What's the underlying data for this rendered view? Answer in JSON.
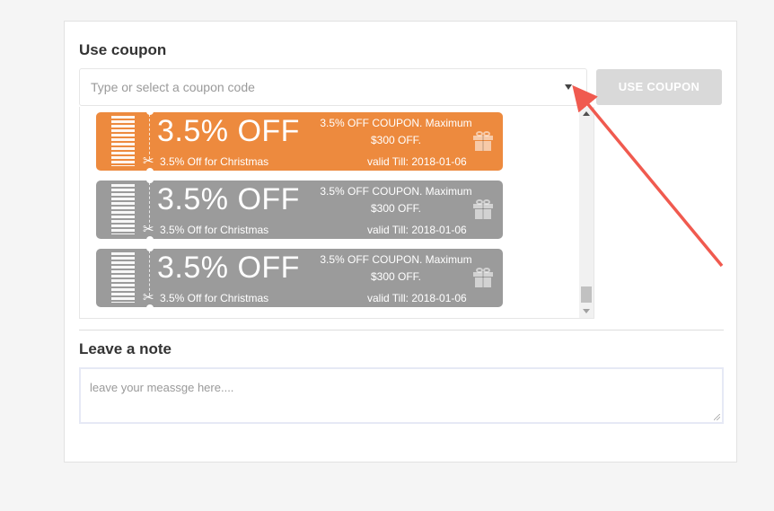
{
  "coupon_section": {
    "title": "Use coupon",
    "input_placeholder": "Type or select a coupon code",
    "use_button_label": "USE COUPON"
  },
  "coupons": [
    {
      "amount": "3.5% OFF",
      "desc_line1": "3.5% OFF COUPON. Maximum",
      "desc_line2": "$300 OFF.",
      "event": "3.5% Off for Christmas",
      "valid": "valid Till: 2018-01-06",
      "color": "#ed8a3e",
      "state": "selected"
    },
    {
      "amount": "3.5% OFF",
      "desc_line1": "3.5% OFF COUPON. Maximum",
      "desc_line2": "$300 OFF.",
      "event": "3.5% Off for Christmas",
      "valid": "valid Till: 2018-01-06",
      "color": "#9b9b9b",
      "state": "normal"
    },
    {
      "amount": "3.5% OFF",
      "desc_line1": "3.5% OFF COUPON. Maximum",
      "desc_line2": "$300 OFF.",
      "event": "3.5% Off for Christmas",
      "valid": "valid Till: 2018-01-06",
      "color": "#9b9b9b",
      "state": "normal"
    }
  ],
  "note_section": {
    "title": "Leave a note",
    "placeholder": "leave your meassge here...."
  },
  "icons": {
    "dropdown": "caret-down-icon",
    "barcode": "barcode-icon",
    "scissors": "scissors-icon",
    "gift": "gift-icon",
    "annotation": "red-arrow"
  },
  "colors": {
    "accent": "#ed8a3e",
    "inactive_coupon": "#9b9b9b",
    "arrow": "#f05a4f",
    "disabled_button": "#d9d9d9"
  }
}
